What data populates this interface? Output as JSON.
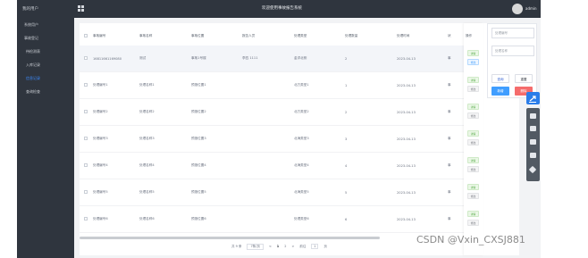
{
  "sidebar": {
    "title": "我的用户",
    "items": [
      {
        "label": "系统用户"
      },
      {
        "label": "事故登记"
      }
    ],
    "subitems": [
      {
        "label": "待检测表"
      },
      {
        "label": "入库记录"
      },
      {
        "label": "信息记录"
      },
      {
        "label": "查询检查"
      }
    ]
  },
  "header": {
    "title": "欢迎使用事故报告系统",
    "username": "admin"
  },
  "table": {
    "columns": [
      "事故编号",
      "事故名称",
      "事故位置",
      "报告人员",
      "处理类型",
      "处理数量",
      "处理时间",
      "状"
    ],
    "rows": [
      [
        "16811661169080",
        "测试",
        "事故1号楼",
        "李四 1111",
        "金洋北侧",
        "2",
        "2023-04-13",
        "事"
      ],
      [
        "处理编号1",
        "处理名称1",
        "预报位置1",
        "",
        "北方类型1",
        "1",
        "2023-04-13",
        "事"
      ],
      [
        "处理编号2",
        "处理名称2",
        "预报位置2",
        "",
        "北方类型2",
        "2",
        "2023-04-13",
        "事"
      ],
      [
        "处理编号3",
        "处理名称3",
        "预报位置3",
        "",
        "北海类型3",
        "3",
        "2023-04-13",
        "事"
      ],
      [
        "处理编号4",
        "处理名称4",
        "预报位置4",
        "",
        "北海类型4",
        "4",
        "2023-04-13",
        "事"
      ],
      [
        "处理编号5",
        "处理名称5",
        "预报位置5",
        "",
        "北海类型5",
        "5",
        "2023-04-13",
        "事"
      ],
      [
        "处理编号6",
        "处理名称6",
        "预报位置6",
        "",
        "处理类型6",
        "6",
        "2023-04-13",
        "事"
      ]
    ]
  },
  "ops": {
    "header": "操作",
    "detail_label": "详情",
    "edit_label": "修改"
  },
  "pagination": {
    "total": "共 9 条",
    "page_size": "7条/页",
    "prev": "<",
    "pages": [
      "1",
      "2"
    ],
    "next": ">",
    "goto_label": "前往",
    "current": "1",
    "page_unit": "页"
  },
  "search": {
    "name_placeholder": "处理编号",
    "type_placeholder": "处理名称",
    "query_label": "查询",
    "reset_label": "重置",
    "add_label": "新增",
    "delete_label": "删除"
  },
  "tools": [
    "export-icon",
    "camera-icon",
    "gallery-icon",
    "layout-icon",
    "cloud-icon",
    "pen-icon"
  ],
  "watermark": "CSDN @Vxin_CXSJ881",
  "colors": {
    "sidebar_bg": "#2f353e",
    "active": "#3d8cff",
    "primary": "#409eff",
    "danger": "#f56c6c",
    "success": "#52a842"
  }
}
